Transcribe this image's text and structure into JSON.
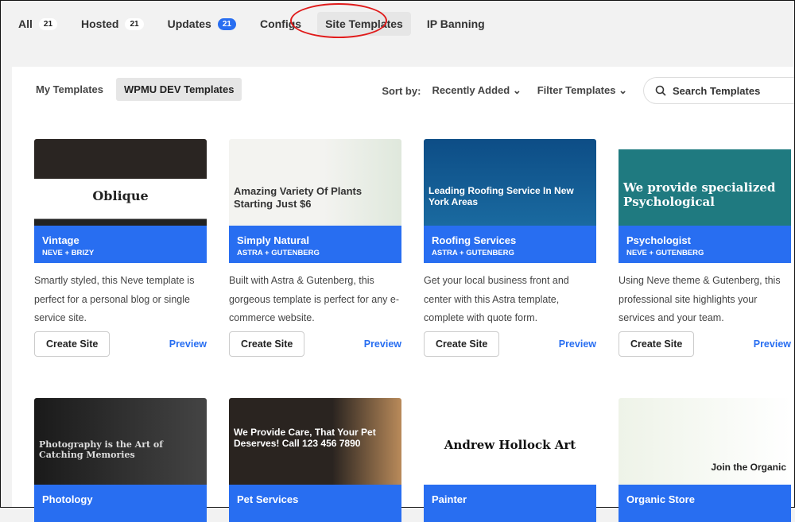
{
  "tabs": [
    {
      "label": "All",
      "badge": "21"
    },
    {
      "label": "Hosted",
      "badge": "21"
    },
    {
      "label": "Updates",
      "badge": "21"
    },
    {
      "label": "Configs"
    },
    {
      "label": "Site Templates"
    },
    {
      "label": "IP Banning"
    }
  ],
  "subtabs": [
    "My Templates",
    "WPMU DEV Templates"
  ],
  "sort": {
    "label": "Sort by:",
    "value": "Recently Added"
  },
  "filter": "Filter Templates",
  "search": {
    "placeholder": "Search Templates"
  },
  "create_label": "Create Site",
  "preview_label": "Preview",
  "templates": [
    {
      "name": "Vintage",
      "stack": "NEVE + BRIZY",
      "desc": "Smartly styled, this Neve template is perfect for a personal blog or single service site.",
      "thumb": "Oblique"
    },
    {
      "name": "Simply Natural",
      "stack": "ASTRA + GUTENBERG",
      "desc": "Built with Astra & Gutenberg, this gorgeous template is perfect for any e-commerce website.",
      "thumb": "Amazing Variety Of Plants Starting Just $6"
    },
    {
      "name": "Roofing Services",
      "stack": "ASTRA + GUTENBERG",
      "desc": "Get your local business front and center with this Astra template, complete with quote form.",
      "thumb": "Leading Roofing Service In New York Areas"
    },
    {
      "name": "Psychologist",
      "stack": "NEVE + GUTENBERG",
      "desc": "Using Neve theme & Gutenberg, this professional site highlights your services and your team.",
      "thumb": "We provide specialized Psychological"
    },
    {
      "name": "Photology",
      "thumb": "Photography is the Art of Catching Memories"
    },
    {
      "name": "Pet Services",
      "thumb": "We Provide Care, That Your Pet Deserves! Call 123 456 7890"
    },
    {
      "name": "Painter",
      "thumb": "Andrew Hollock Art"
    },
    {
      "name": "Organic Store",
      "thumb": "Join the Organic"
    }
  ],
  "colors": {
    "accent": "#286ef1",
    "highlight": "#e01b1b"
  }
}
